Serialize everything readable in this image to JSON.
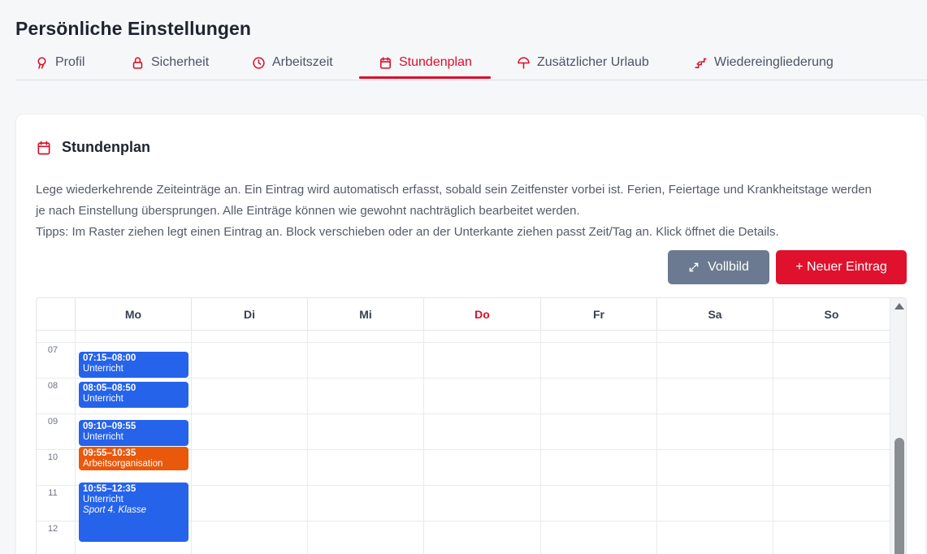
{
  "page": {
    "title": "Persönliche Einstellungen"
  },
  "tabs": [
    {
      "label": "Profil",
      "icon": "profile-icon"
    },
    {
      "label": "Sicherheit",
      "icon": "lock-icon"
    },
    {
      "label": "Arbeitszeit",
      "icon": "clock-icon"
    },
    {
      "label": "Stundenplan",
      "icon": "calendar-icon",
      "active": true
    },
    {
      "label": "Zusätzlicher Urlaub",
      "icon": "umbrella-icon"
    },
    {
      "label": "Wiedereingliederung",
      "icon": "steps-icon"
    }
  ],
  "card": {
    "title": "Stundenplan",
    "description_1": "Lege wiederkehrende Zeiteinträge an. Ein Eintrag wird automatisch erfasst, sobald sein Zeitfenster vorbei ist. Ferien, Feiertage und Krankheitstage werden je nach Einstellung übersprungen. Alle Einträge können wie gewohnt nachträglich bearbeitet werden.",
    "description_2": "Tipps: Im Raster ziehen legt einen Eintrag an. Block verschieben oder an der Unterkante ziehen passt Zeit/Tag an. Klick öffnet die Details."
  },
  "buttons": {
    "fullscreen": "Vollbild",
    "new_entry": "+ Neuer Eintrag"
  },
  "calendar": {
    "days": [
      "Mo",
      "Di",
      "Mi",
      "Do",
      "Fr",
      "Sa",
      "So"
    ],
    "today": "Do",
    "hours": [
      "07",
      "08",
      "09",
      "10",
      "11",
      "12"
    ],
    "events": [
      {
        "time": "07:15–08:00",
        "category": "Unterricht",
        "subject": "",
        "color": "#2563eb"
      },
      {
        "time": "08:05–08:50",
        "category": "Unterricht",
        "subject": "",
        "color": "#2563eb"
      },
      {
        "time": "09:10–09:55",
        "category": "Unterricht",
        "subject": "",
        "color": "#2563eb"
      },
      {
        "time": "09:55–10:35",
        "category": "Arbeitsorganisation",
        "subject": "",
        "color": "#ea580c"
      },
      {
        "time": "10:55–12:35",
        "category": "Unterricht",
        "subject": "Sport 4. Klasse",
        "color": "#2563eb"
      }
    ]
  },
  "colors": {
    "accent": "#d90f2a",
    "event_blue": "#2563eb",
    "event_orange": "#ea580c",
    "button_grey": "#6b7a90"
  }
}
